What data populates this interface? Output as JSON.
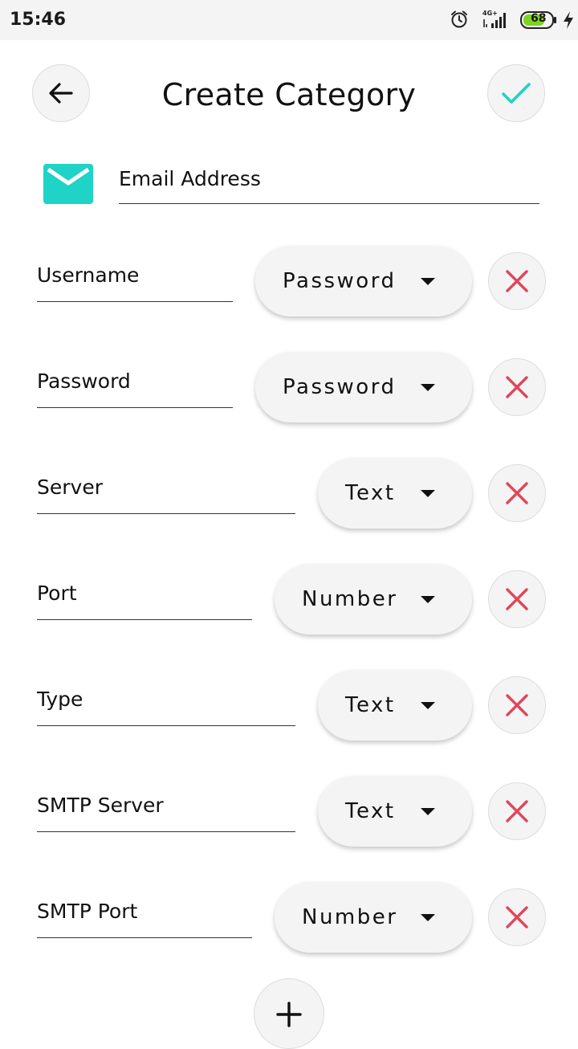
{
  "status_bar": {
    "time": "15:46",
    "network_label": "4G+",
    "battery_level": "68",
    "icons": [
      "alarm-icon",
      "signal-icon",
      "battery-icon",
      "charging-icon"
    ],
    "colors": {
      "battery_fill": "#7ed321"
    }
  },
  "header": {
    "title": "Create Category",
    "back_icon": "arrow-left-icon",
    "confirm_icon": "checkmark-icon"
  },
  "category": {
    "icon": "mail-icon",
    "name": "Email Address"
  },
  "fields": [
    {
      "name": "Username",
      "type": "Password"
    },
    {
      "name": "Password",
      "type": "Password"
    },
    {
      "name": "Server",
      "type": "Text"
    },
    {
      "name": "Port",
      "type": "Number"
    },
    {
      "name": "Type",
      "type": "Text"
    },
    {
      "name": "SMTP Server",
      "type": "Text"
    },
    {
      "name": "SMTP Port",
      "type": "Number"
    }
  ],
  "actions": {
    "add_icon": "plus-icon",
    "delete_icon": "close-icon"
  },
  "colors": {
    "accent": "#1fd3c6",
    "delete": "#e0455a",
    "button_bg": "#f4f4f4",
    "underline": "#333333"
  }
}
